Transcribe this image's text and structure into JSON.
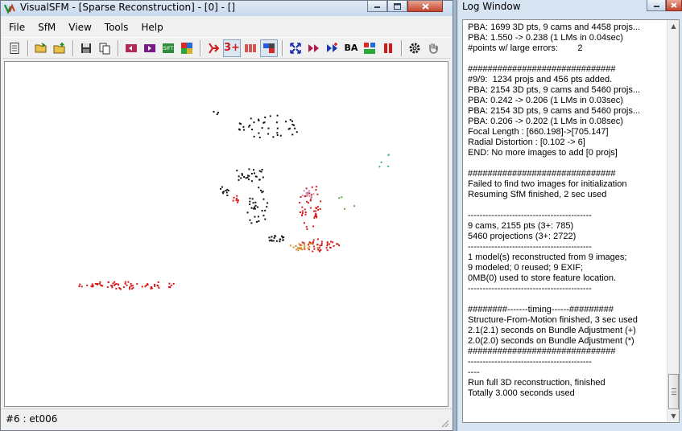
{
  "main_window": {
    "title": "VisualSFM - [Sparse Reconstruction] - [0] - []",
    "menu": [
      "File",
      "SfM",
      "View",
      "Tools",
      "Help"
    ],
    "toolbar_labels": {
      "three_plus": "3+",
      "ba": "BA"
    },
    "status": "#6 : et006"
  },
  "log_window": {
    "title": "Log Window",
    "lines": [
      "PBA: 1699 3D pts, 9 cams and 4458 projs...",
      "PBA: 1.550 -> 0.238 (1 LMs in 0.04sec)",
      "#points w/ large errors:        2",
      "",
      "##############################",
      "#9/9:  1234 projs and 456 pts added.",
      "PBA: 2154 3D pts, 9 cams and 5460 projs...",
      "PBA: 0.242 -> 0.206 (1 LMs in 0.03sec)",
      "PBA: 2154 3D pts, 9 cams and 5460 projs...",
      "PBA: 0.206 -> 0.202 (1 LMs in 0.08sec)",
      "Focal Length : [660.198]->[705.147]",
      "Radial Distortion : [0.102 -> 6]",
      "END: No more images to add [0 projs]",
      "",
      "##############################",
      "Failed to find two images for initialization",
      "Resuming SfM finished, 2 sec used",
      "",
      "------------------------------------------",
      "9 cams, 2155 pts (3+: 785)",
      "5460 projections (3+: 2722)",
      "------------------------------------------",
      "1 model(s) reconstructed from 9 images;",
      "9 modeled; 0 reused; 9 EXIF;",
      "0MB(0) used to store feature location.",
      "------------------------------------------",
      "",
      "########-------timing------#########",
      "Structure-From-Motion finished, 3 sec used",
      "2.1(2.1) seconds on Bundle Adjustment (+)",
      "2.0(2.0) seconds on Bundle Adjustment (*)",
      "##############################",
      "------------------------------------------",
      "----",
      "Run full 3D reconstruction, finished",
      "Totally 3.000 seconds used"
    ]
  },
  "colors": {
    "point_black": "#111111",
    "point_red": "#d81818",
    "point_orange": "#d48a1e",
    "point_pink": "#c98aa8",
    "point_teal": "#3bb0a0",
    "point_green": "#5aa84a"
  }
}
